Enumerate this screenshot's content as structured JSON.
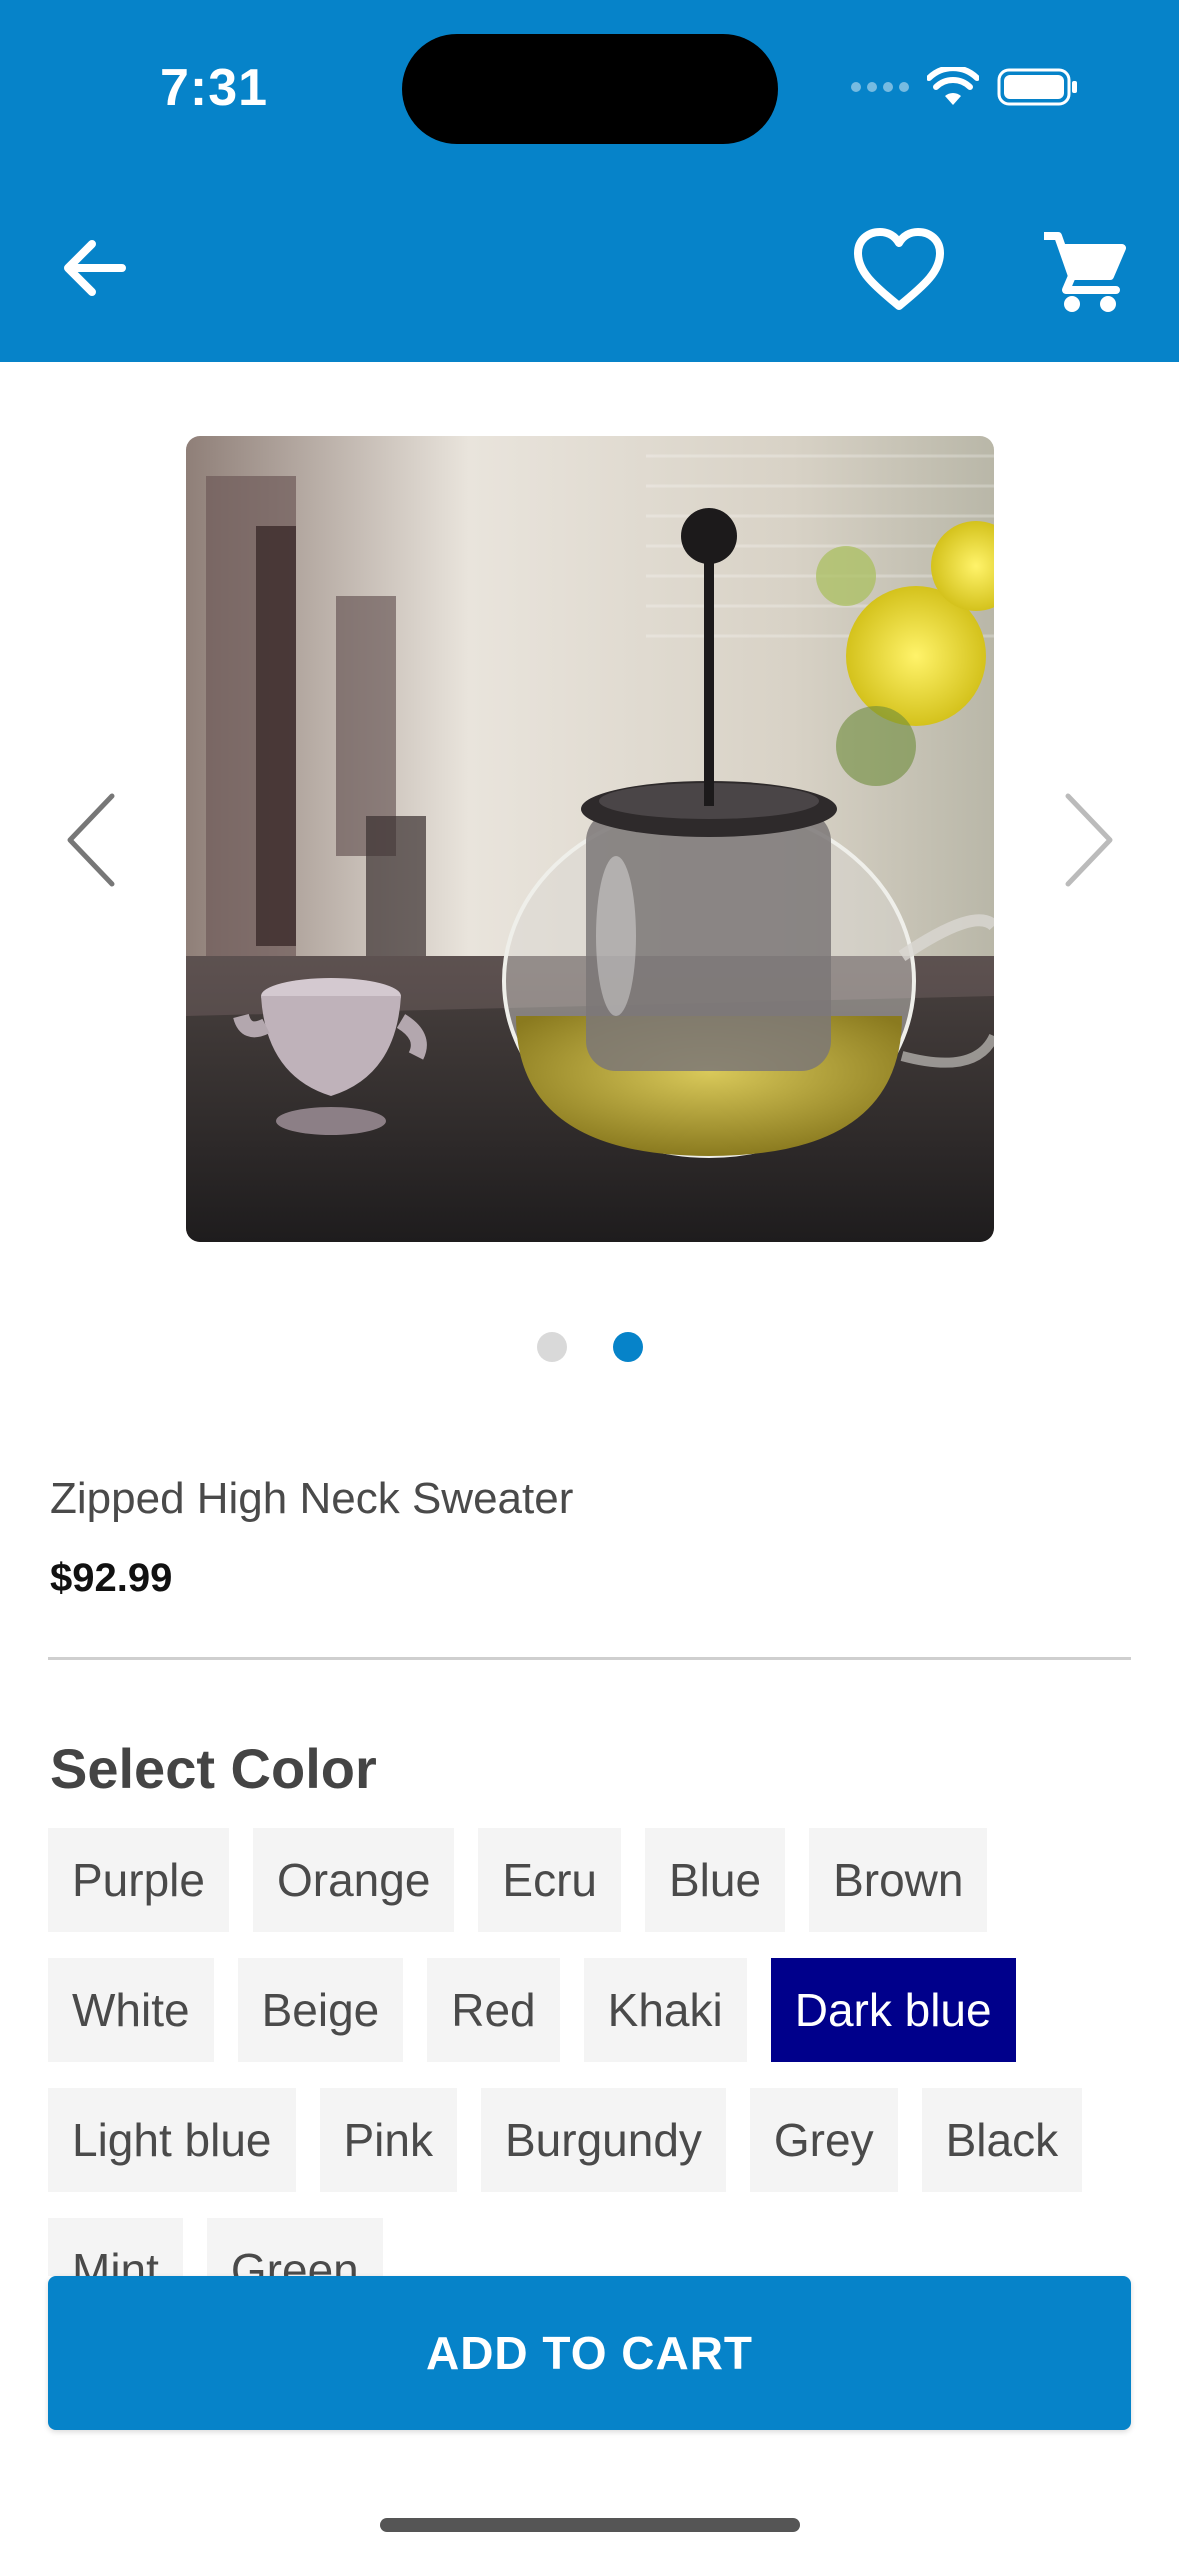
{
  "status_bar": {
    "time": "7:31"
  },
  "header": {
    "back_icon": "arrow-left-icon",
    "favorite_icon": "heart-outline-icon",
    "cart_icon": "shopping-cart-icon",
    "background_color": "#0683c9"
  },
  "carousel": {
    "prev_icon": "chevron-left-icon",
    "next_icon": "chevron-right-icon",
    "page_count": 2,
    "active_page": 2
  },
  "product": {
    "name": "Zipped High Neck Sweater",
    "price": "$92.99"
  },
  "color_section": {
    "title": "Select Color",
    "selected": "Dark blue",
    "options": [
      [
        "Purple",
        "Orange",
        "Ecru",
        "Blue",
        "Brown"
      ],
      [
        "White",
        "Beige",
        "Red",
        "Khaki",
        "Dark blue"
      ],
      [
        "Light blue",
        "Pink",
        "Burgundy",
        "Grey",
        "Black"
      ],
      [
        "Mint",
        "Green"
      ]
    ],
    "selected_color": "#00008b"
  },
  "actions": {
    "add_to_cart": "ADD TO CART"
  }
}
